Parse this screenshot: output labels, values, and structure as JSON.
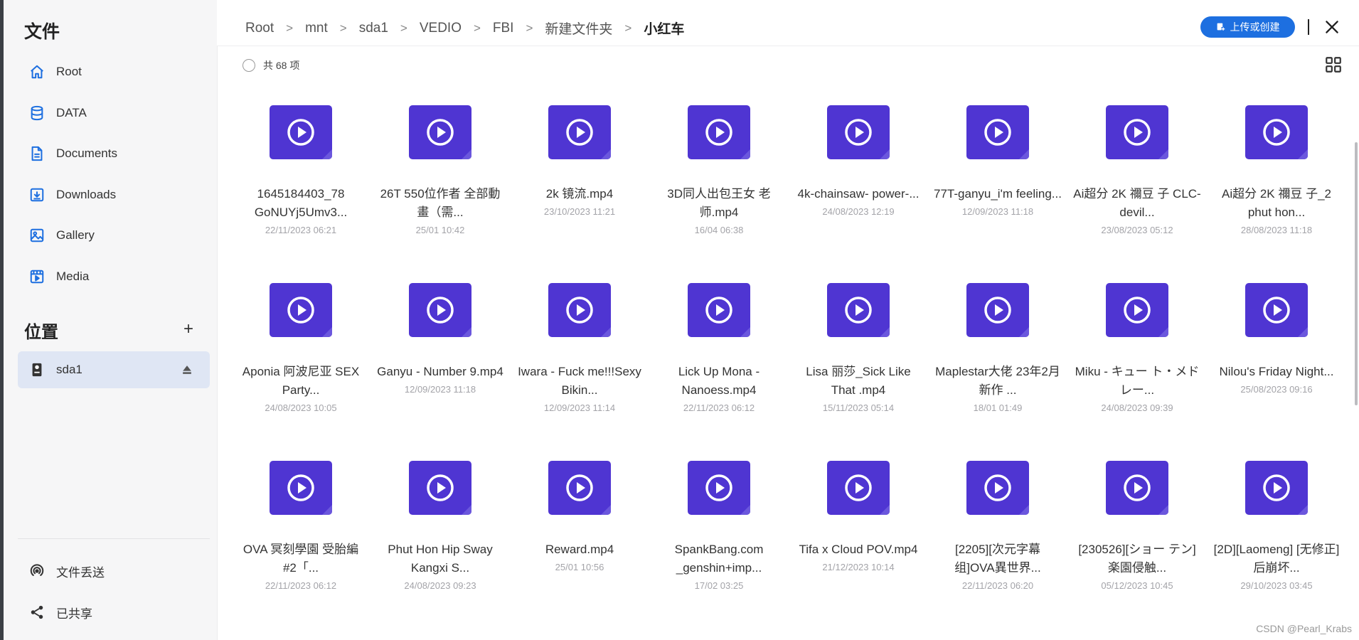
{
  "sidebar": {
    "title": "文件",
    "nav": [
      {
        "label": "Root",
        "icon": "home-icon"
      },
      {
        "label": "DATA",
        "icon": "database-icon"
      },
      {
        "label": "Documents",
        "icon": "document-icon"
      },
      {
        "label": "Downloads",
        "icon": "download-icon"
      },
      {
        "label": "Gallery",
        "icon": "gallery-icon"
      },
      {
        "label": "Media",
        "icon": "media-icon"
      }
    ],
    "locations_title": "位置",
    "add_label": "+",
    "location": {
      "label": "sda1",
      "icon": "drive-icon"
    },
    "bottom": [
      {
        "label": "文件丢送",
        "icon": "airdrop-icon"
      },
      {
        "label": "已共享",
        "icon": "share-icon"
      }
    ]
  },
  "header": {
    "breadcrumbs": [
      "Root",
      "mnt",
      "sda1",
      "VEDIO",
      "FBI",
      "新建文件夹",
      "小红车"
    ],
    "separator": ">",
    "upload_label": "上传或创建"
  },
  "toolbar": {
    "count_label": "共 68 项"
  },
  "colors": {
    "accent": "#1d6fe0",
    "thumb": "#4f35d2",
    "sidebar_bg": "#f6f6f7",
    "active_bg": "#dfe6f4"
  },
  "files": [
    {
      "name": "1645184403_78 GoNUYj5Umv3...",
      "date": "22/11/2023 06:21"
    },
    {
      "name": "26T 550位作者 全部動畫（需...",
      "date": "25/01 10:42"
    },
    {
      "name": "2k 镜流.mp4",
      "date": "23/10/2023 11:21"
    },
    {
      "name": "3D同人出包王女 老师.mp4",
      "date": "16/04 06:38"
    },
    {
      "name": "4k-chainsaw- power-...",
      "date": "24/08/2023 12:19"
    },
    {
      "name": "77T-ganyu_i'm feeling...",
      "date": "12/09/2023 11:18"
    },
    {
      "name": "Ai超分 2K 禰豆 子 CLC-devil...",
      "date": "23/08/2023 05:12"
    },
    {
      "name": "Ai超分 2K 禰豆 子_2 phut hon...",
      "date": "28/08/2023 11:18"
    },
    {
      "name": "Aponia 阿波尼亚 SEX Party...",
      "date": "24/08/2023 10:05"
    },
    {
      "name": "Ganyu - Number 9.mp4",
      "date": "12/09/2023 11:18"
    },
    {
      "name": "Iwara - Fuck me!!!Sexy Bikin...",
      "date": "12/09/2023 11:14"
    },
    {
      "name": "Lick Up Mona - Nanoess.mp4",
      "date": "22/11/2023 06:12"
    },
    {
      "name": "Lisa 丽莎_Sick Like That .mp4",
      "date": "15/11/2023 05:14"
    },
    {
      "name": "Maplestar大佬 23年2月新作 ...",
      "date": "18/01 01:49"
    },
    {
      "name": "Miku - キュー ト・メドレー...",
      "date": "24/08/2023 09:39"
    },
    {
      "name": "Nilou's Friday Night...",
      "date": "25/08/2023 09:16"
    },
    {
      "name": "OVA 冥刻學園 受胎編 #2「...",
      "date": "22/11/2023 06:12"
    },
    {
      "name": "Phut Hon Hip Sway Kangxi S...",
      "date": "24/08/2023 09:23"
    },
    {
      "name": "Reward.mp4",
      "date": "25/01 10:56"
    },
    {
      "name": "SpankBang.com _genshin+imp...",
      "date": "17/02 03:25"
    },
    {
      "name": "Tifa x Cloud POV.mp4",
      "date": "21/12/2023 10:14"
    },
    {
      "name": "[2205][次元字幕 组]OVA異世界...",
      "date": "22/11/2023 06:20"
    },
    {
      "name": "[230526][ショー テン]楽園侵触...",
      "date": "05/12/2023 10:45"
    },
    {
      "name": "[2D][Laomeng] [无修正]后崩坏...",
      "date": "29/10/2023 03:45"
    }
  ],
  "watermark": "CSDN @Pearl_Krabs"
}
